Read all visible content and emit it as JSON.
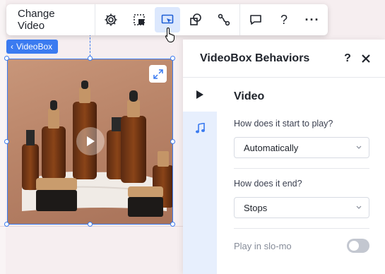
{
  "toolbar": {
    "change_video_label": "Change Video",
    "icons": [
      "gear-icon",
      "crop-icon",
      "behaviors-icon",
      "layers-icon",
      "animation-icon",
      "comment-icon",
      "help-icon",
      "more-icon"
    ],
    "help_glyph": "?",
    "more_glyph": "···"
  },
  "element_tag": {
    "label": "VideoBox",
    "chevron": "‹"
  },
  "panel": {
    "title": "VideoBox Behaviors",
    "help_glyph": "?",
    "section_title": "Video",
    "start_label": "How does it start to play?",
    "start_value": "Automatically",
    "end_label": "How does it end?",
    "end_value": "Stops",
    "slomo_label": "Play in slo-mo",
    "slomo_on": false
  },
  "colors": {
    "accent": "#3b7bf0",
    "rail_bg": "#e7effd",
    "active_tool_bg": "#dce8fd"
  }
}
